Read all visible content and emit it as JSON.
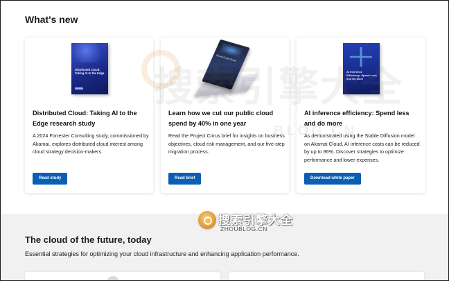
{
  "whats_new": {
    "title": "What's new",
    "cards": [
      {
        "cover_text": "Distributed Cloud: Taking AI to the Edge",
        "title": "Distributed Cloud: Taking AI to the Edge research study",
        "description": "A 2024 Forrester Consulting study, commissioned by Akamai, explores distributed cloud interest among cloud strategy decision-makers.",
        "button": "Read study"
      },
      {
        "cover_text": "Cloud Costs Down",
        "title": "Learn how we cut our public cloud spend by 40% in one year",
        "description": "Read the Project Cirrus brief for insights on business objectives, cloud risk management, and our five-step migration process.",
        "button": "Read brief"
      },
      {
        "cover_text": "AI Inference Efficiency: Spend Less and Do More",
        "title": "AI inference efficiency: Spend less and do more",
        "description": "As demonstrated using the Stable Diffusion model on Akamai Cloud, AI inference costs can be reduced by up to 86%. Discover strategies to optimize performance and lower expenses.",
        "button": "Download white paper"
      }
    ]
  },
  "future": {
    "title": "The cloud of the future, today",
    "subtitle": "Essential strategies for optimizing your cloud infrastructure and enhancing application performance."
  },
  "watermark": {
    "large": "搜索引擎大全",
    "sub": "BLOG.CN",
    "small": "搜索引擎大全",
    "url": "ZHOUBLOG.CN"
  },
  "colors": {
    "button": "#0a5fb4",
    "lower_section_bg": "#f1f1f1"
  }
}
